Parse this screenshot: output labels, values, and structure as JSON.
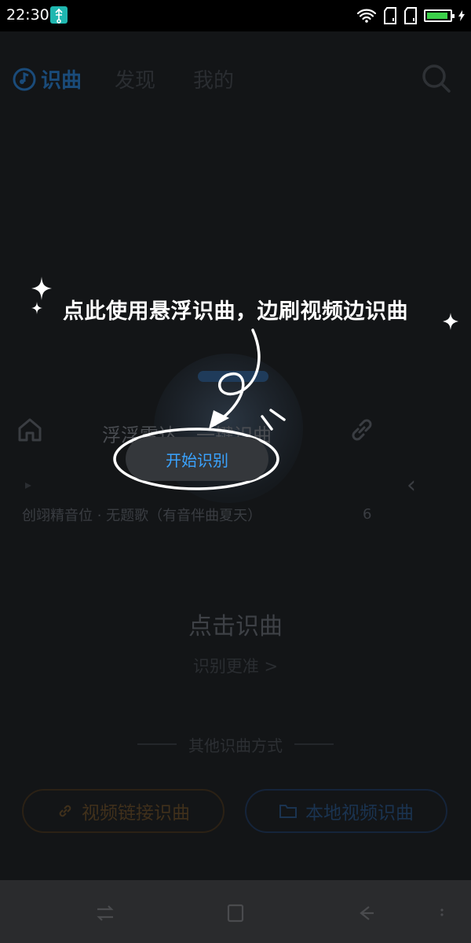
{
  "status_bar": {
    "time": "22:30"
  },
  "top_nav": {
    "tabs": [
      {
        "label": "识曲"
      },
      {
        "label": "发现"
      },
      {
        "label": "我的"
      }
    ]
  },
  "radar": {
    "label": "浮浮雷达，一键识曲"
  },
  "now_playing": {
    "text": "创翊精音位 · 无题歌（有音伴曲夏天）",
    "trailing": "6"
  },
  "recognize": {
    "title": "点击识曲",
    "subtitle": "识别更准 >"
  },
  "divider": {
    "text": "其他识曲方式"
  },
  "bottom_buttons": {
    "video_link": "视频链接识曲",
    "local_video": "本地视频识曲"
  },
  "overlay": {
    "hint": "点此使用悬浮识曲，边刷视频边识曲",
    "start_button": "开始识别"
  },
  "colors": {
    "accent": "#3aa3ff",
    "battery": "#3bd14a",
    "usb": "#1fb7b0"
  }
}
